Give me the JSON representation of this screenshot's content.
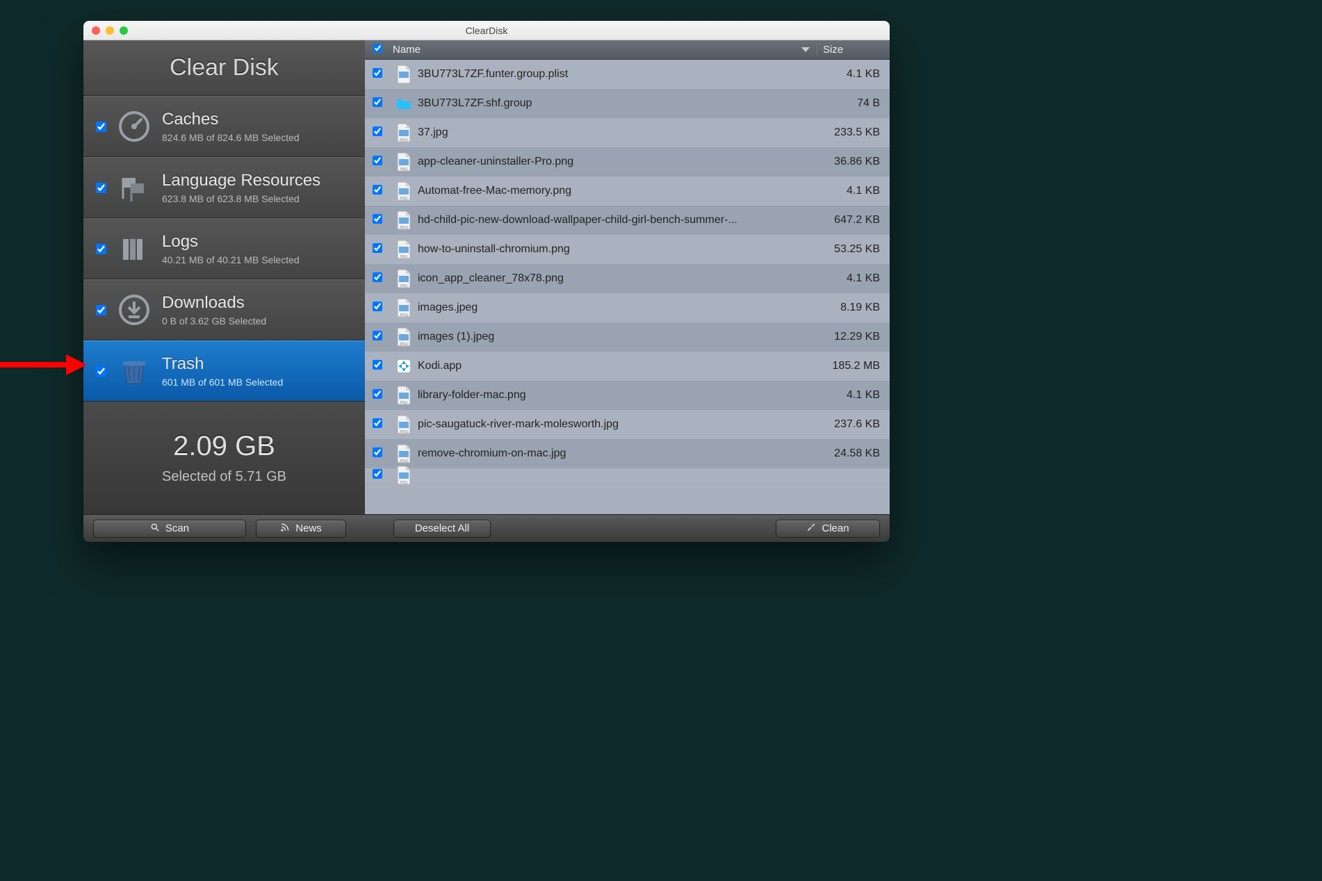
{
  "window": {
    "title": "ClearDisk"
  },
  "brand": "Clear Disk",
  "categories": [
    {
      "id": "caches",
      "title": "Caches",
      "sub": "824.6 MB of 824.6 MB Selected",
      "selected": false,
      "icon": "gauge"
    },
    {
      "id": "lang",
      "title": "Language Resources",
      "sub": "623.8 MB of 623.8 MB Selected",
      "selected": false,
      "icon": "flags"
    },
    {
      "id": "logs",
      "title": "Logs",
      "sub": "40.21 MB of 40.21 MB Selected",
      "selected": false,
      "icon": "books"
    },
    {
      "id": "downloads",
      "title": "Downloads",
      "sub": "0 B of 3.62 GB Selected",
      "selected": false,
      "icon": "download"
    },
    {
      "id": "trash",
      "title": "Trash",
      "sub": "601 MB of 601 MB Selected",
      "selected": true,
      "icon": "trash"
    }
  ],
  "totals": {
    "big": "2.09 GB",
    "sub": "Selected of 5.71 GB"
  },
  "columns": {
    "name": "Name",
    "size": "Size"
  },
  "files": [
    {
      "name": "3BU773L7ZF.funter.group.plist",
      "size": "4.1 KB",
      "type": "plist"
    },
    {
      "name": "3BU773L7ZF.shf.group",
      "size": "74 B",
      "type": "folder"
    },
    {
      "name": "37.jpg",
      "size": "233.5 KB",
      "type": "jpeg"
    },
    {
      "name": "app-cleaner-uninstaller-Pro.png",
      "size": "36.86 KB",
      "type": "png"
    },
    {
      "name": "Automat-free-Mac-memory.png",
      "size": "4.1 KB",
      "type": "png"
    },
    {
      "name": "hd-child-pic-new-download-wallpaper-child-girl-bench-summer-...",
      "size": "647.2 KB",
      "type": "jpeg"
    },
    {
      "name": "how-to-uninstall-chromium.png",
      "size": "53.25 KB",
      "type": "png"
    },
    {
      "name": "icon_app_cleaner_78x78.png",
      "size": "4.1 KB",
      "type": "png"
    },
    {
      "name": "images.jpeg",
      "size": "8.19 KB",
      "type": "jpeg"
    },
    {
      "name": "images (1).jpeg",
      "size": "12.29 KB",
      "type": "jpeg"
    },
    {
      "name": "Kodi.app",
      "size": "185.2 MB",
      "type": "app"
    },
    {
      "name": "library-folder-mac.png",
      "size": "4.1 KB",
      "type": "png"
    },
    {
      "name": "pic-saugatuck-river-mark-molesworth.jpg",
      "size": "237.6 KB",
      "type": "jpeg"
    },
    {
      "name": "remove-chromium-on-mac.jpg",
      "size": "24.58 KB",
      "type": "jpeg"
    }
  ],
  "buttons": {
    "scan": "Scan",
    "news": "News",
    "deselect": "Deselect All",
    "clean": "Clean"
  }
}
